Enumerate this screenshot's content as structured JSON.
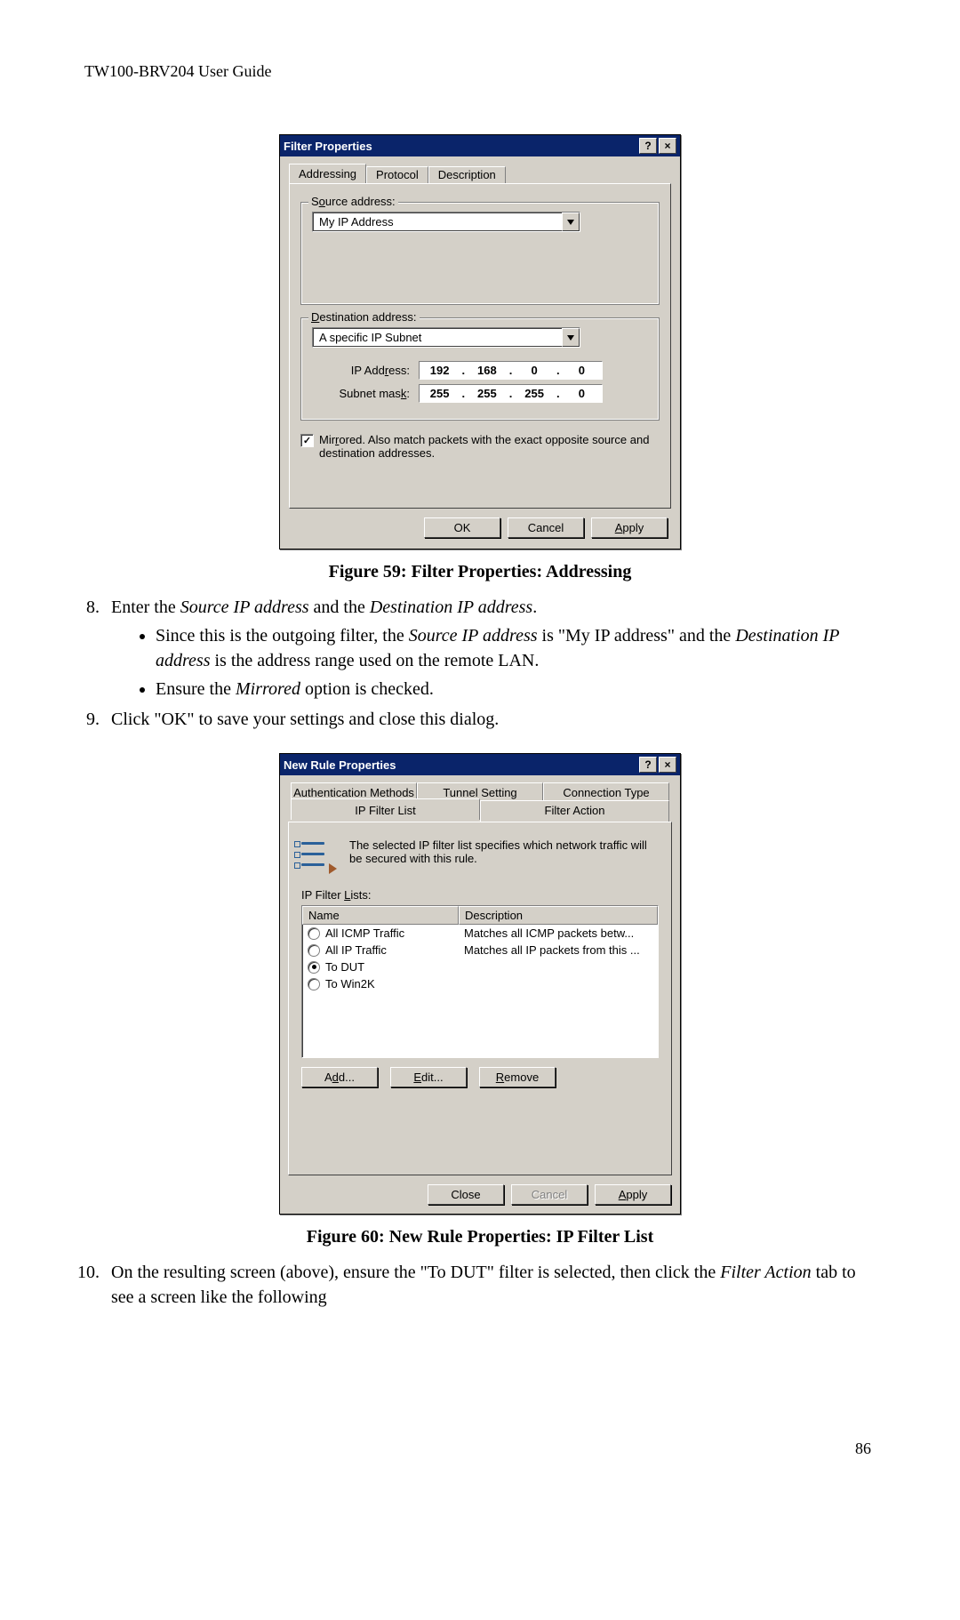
{
  "header": "TW100-BRV204 User Guide",
  "page_number": "86",
  "dlg1": {
    "title": "Filter Properties",
    "tabs": {
      "addressing": "Addressing",
      "protocol": "Protocol",
      "description": "Description"
    },
    "source_legend_pre": "S",
    "source_legend_u": "o",
    "source_legend_post": "urce address:",
    "source_value": "My IP Address",
    "dest_legend_pre": "",
    "dest_legend_u": "D",
    "dest_legend_post": "estination address:",
    "dest_value": "A specific IP Subnet",
    "ip_label_pre": "IP Add",
    "ip_label_u": "r",
    "ip_label_post": "ess:",
    "mask_label_pre": "Subnet mas",
    "mask_label_u": "k",
    "mask_label_post": ":",
    "ip": {
      "o1": "192",
      "o2": "168",
      "o3": "0",
      "o4": "0"
    },
    "mask": {
      "o1": "255",
      "o2": "255",
      "o3": "255",
      "o4": "0"
    },
    "mirrored_pre": "Mir",
    "mirrored_u": "r",
    "mirrored_post": "ored. Also match packets with the exact opposite source and destination addresses.",
    "ok": "OK",
    "cancel": "Cancel",
    "apply_u": "A",
    "apply_post": "pply"
  },
  "cap1": "Figure 59: Filter Properties: Addressing",
  "step8_a": "Enter the ",
  "step8_i1": "Source IP address",
  "step8_b": " and the ",
  "step8_i2": "Destination IP address",
  "step8_c": ".",
  "step8_bul1_a": "Since this is the outgoing filter, the ",
  "step8_bul1_i1": "Source IP address",
  "step8_bul1_b": " is \"My IP address\" and the ",
  "step8_bul1_i2": "Destination IP address",
  "step8_bul1_c": " is the address range used on the remote LAN.",
  "step8_bul2_a": "Ensure the ",
  "step8_bul2_i": "Mirrored",
  "step8_bul2_b": " option is checked.",
  "step9": "Click \"OK\" to save your settings and close this dialog.",
  "dlg2": {
    "title": "New Rule Properties",
    "tabs_back": {
      "auth": "Authentication Methods",
      "tunnel": "Tunnel Setting",
      "conn": "Connection Type"
    },
    "tabs_front": {
      "ipfilter": "IP Filter List",
      "action": "Filter Action"
    },
    "info": "The selected IP filter list specifies which network traffic will be secured with this rule.",
    "list_label_pre": "IP Filter ",
    "list_label_u": "L",
    "list_label_post": "ists:",
    "col_name": "Name",
    "col_desc": "Description",
    "rows": [
      {
        "name": "All ICMP Traffic",
        "desc": "Matches all ICMP packets betw...",
        "selected": false
      },
      {
        "name": "All IP Traffic",
        "desc": "Matches all IP packets from this ...",
        "selected": false
      },
      {
        "name": "To DUT",
        "desc": "",
        "selected": true
      },
      {
        "name": "To Win2K",
        "desc": "",
        "selected": false
      }
    ],
    "add_pre": "A",
    "add_u": "d",
    "add_post": "d...",
    "edit_u": "E",
    "edit_post": "dit...",
    "remove_u": "R",
    "remove_post": "emove",
    "close": "Close",
    "cancel_d": "Cancel",
    "apply_u": "A",
    "apply_post": "pply"
  },
  "cap2": "Figure 60: New Rule Properties: IP Filter List",
  "step10_a": "On the resulting screen (above), ensure the \"To DUT\" filter is selected, then click the ",
  "step10_i": "Filter Action",
  "step10_b": " tab to see a screen like the following"
}
